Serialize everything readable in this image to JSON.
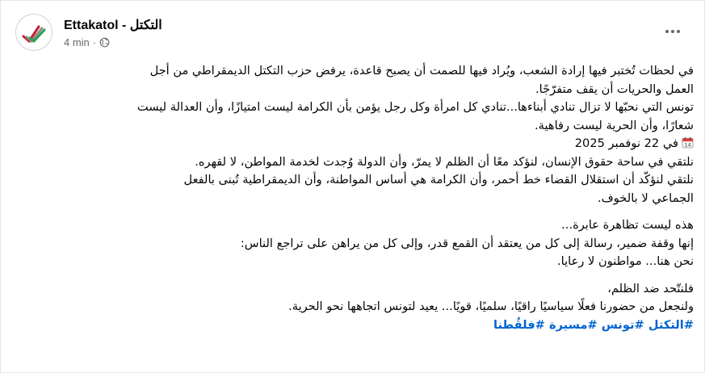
{
  "post": {
    "author": "Ettakatol - التكتل",
    "time": "4 min",
    "dot": "·",
    "icons": {
      "avatar": "ettakatol-logo",
      "audience": "globe-icon",
      "more": "more-options-icon",
      "calendar": "calendar-icon"
    },
    "lines": [
      "في لحظات تُختبر فيها إرادة الشعب، ويُراد فيها للصمت أن يصبح قاعدة، يرفض حزب التكتل الديمقراطي من أجل",
      "العمل والحريات أن يقف متفرّجًا.",
      "تونس التي نحبّها لا تزال تنادي أبناءها...تنادي كل امرأة وكل رجل يؤمن بأن الكرامة ليست امتيازًا، وأن العدالة ليست",
      "شعارًا، وأن الحرية ليست رفاهية.",
      "في 22 نوفمبر 2025",
      "نلتقي في ساحة حقوق الإنسان، لنؤكد معًا أن الظلم لا يمرّ، وأن الدولة وُجدت لخدمة المواطن، لا لقهره.",
      "نلتقي لنؤكّد أن استقلال القضاء خط أحمر، وأن الكرامة هي أساس المواطنة، وأن الديمقراطية تُبنى بالفعل",
      "الجماعي لا بالخوف.",
      "هذه ليست تظاهرة عابرة...",
      "إنها وقفة ضمير، رسالة إلى كل من يعتقد أن القمع قدر، وإلى كل من يراهن على تراجع الناس:",
      "نحن هنا... مواطنون لا رعايا.",
      "فلنتّحد ضد الظلم،",
      "ولنجعل من حضورنا فعلًا سياسيًا راقيًا، سلميًا، قويًا... يعيد لتونس اتجاهها نحو الحرية."
    ],
    "hashtags": "#التكتل #تونس #مسيرة #فلقُطنا"
  }
}
